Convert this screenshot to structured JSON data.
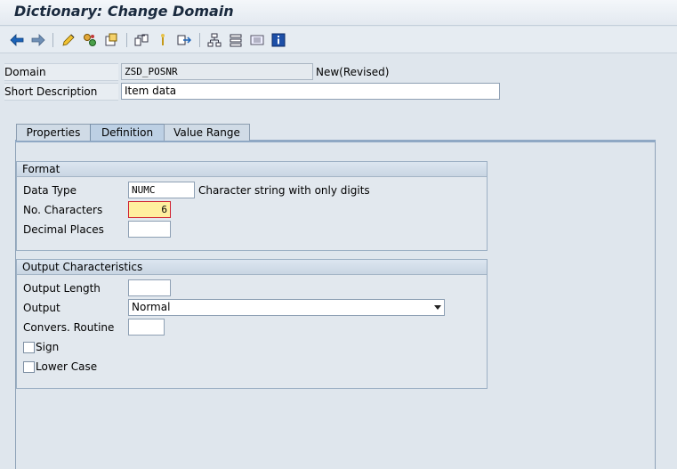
{
  "title": "Dictionary: Change Domain",
  "toolbar": {
    "icons": [
      "back-icon",
      "forward-icon",
      "display-change-icon",
      "other-object-icon",
      "activate-icon",
      "check-icon",
      "where-used-icon",
      "navigate-icon",
      "hierarchy-icon",
      "list-icon",
      "info-icon"
    ]
  },
  "header": {
    "domain_label": "Domain",
    "domain_value": "ZSD_POSNR",
    "domain_status": "New(Revised)",
    "short_desc_label": "Short Description",
    "short_desc_value": "Item data"
  },
  "tabs": [
    {
      "label": "Properties",
      "active": false
    },
    {
      "label": "Definition",
      "active": true
    },
    {
      "label": "Value Range",
      "active": false
    }
  ],
  "format": {
    "title": "Format",
    "data_type_label": "Data Type",
    "data_type_value": "NUMC",
    "data_type_desc": "Character string with only digits",
    "no_chars_label": "No. Characters",
    "no_chars_value": "6",
    "decimal_label": "Decimal Places",
    "decimal_value": ""
  },
  "output": {
    "title": "Output Characteristics",
    "length_label": "Output Length",
    "length_value": "",
    "output_label": "Output",
    "output_value": "Normal",
    "routine_label": "Convers. Routine",
    "routine_value": "",
    "sign_label": "Sign",
    "lowercase_label": "Lower Case"
  },
  "colors": {
    "highlight_field": "#ffef9f",
    "highlight_border": "#d02030"
  }
}
